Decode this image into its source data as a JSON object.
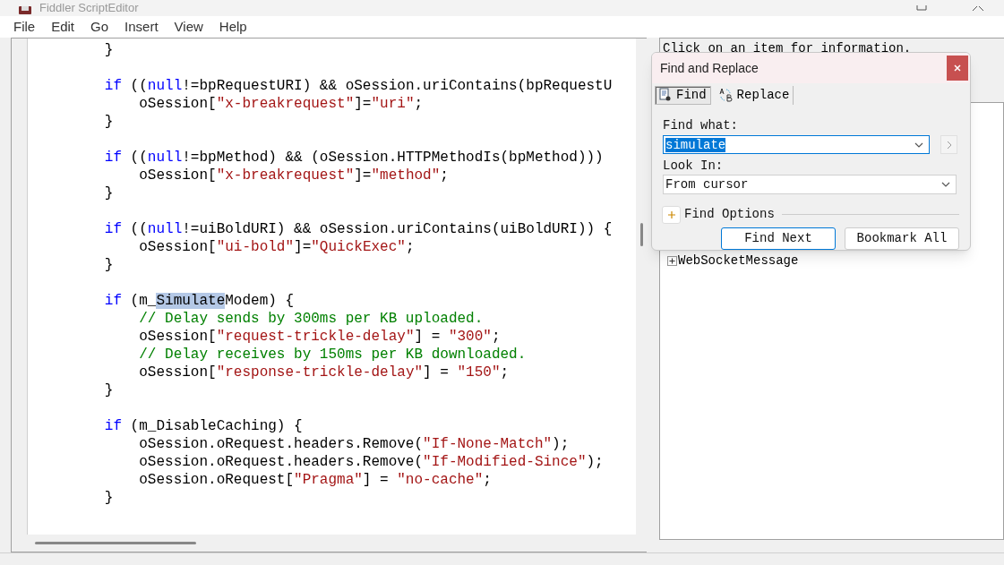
{
  "window": {
    "title": "Fiddler ScriptEditor"
  },
  "menu": [
    "File",
    "Edit",
    "Go",
    "Insert",
    "View",
    "Help"
  ],
  "editor": {
    "lines": [
      {
        "kind": "code",
        "segments": [
          {
            "kind": "plain",
            "text": "        }"
          }
        ]
      },
      {
        "kind": "blank"
      },
      {
        "kind": "code",
        "segments": [
          {
            "kind": "keyword",
            "text": "        if"
          },
          {
            "kind": "plain",
            "text": " (("
          },
          {
            "kind": "keyword",
            "text": "null"
          },
          {
            "kind": "plain",
            "text": "!=bpRequestURI) && oSession.uriContains(bpRequestU"
          }
        ]
      },
      {
        "kind": "code",
        "segments": [
          {
            "kind": "plain",
            "text": "            oSession["
          },
          {
            "kind": "string",
            "text": "\"x-breakrequest\""
          },
          {
            "kind": "plain",
            "text": "]="
          },
          {
            "kind": "string",
            "text": "\"uri\""
          },
          {
            "kind": "plain",
            "text": ";"
          }
        ]
      },
      {
        "kind": "code",
        "segments": [
          {
            "kind": "plain",
            "text": "        }"
          }
        ]
      },
      {
        "kind": "blank"
      },
      {
        "kind": "code",
        "segments": [
          {
            "kind": "keyword",
            "text": "        if"
          },
          {
            "kind": "plain",
            "text": " (("
          },
          {
            "kind": "keyword",
            "text": "null"
          },
          {
            "kind": "plain",
            "text": "!=bpMethod) && (oSession.HTTPMethodIs(bpMethod)))"
          }
        ]
      },
      {
        "kind": "code",
        "segments": [
          {
            "kind": "plain",
            "text": "            oSession["
          },
          {
            "kind": "string",
            "text": "\"x-breakrequest\""
          },
          {
            "kind": "plain",
            "text": "]="
          },
          {
            "kind": "string",
            "text": "\"method\""
          },
          {
            "kind": "plain",
            "text": ";"
          }
        ]
      },
      {
        "kind": "code",
        "segments": [
          {
            "kind": "plain",
            "text": "        }"
          }
        ]
      },
      {
        "kind": "blank"
      },
      {
        "kind": "code",
        "segments": [
          {
            "kind": "keyword",
            "text": "        if"
          },
          {
            "kind": "plain",
            "text": " (("
          },
          {
            "kind": "keyword",
            "text": "null"
          },
          {
            "kind": "plain",
            "text": "!=uiBoldURI) && oSession.uriContains(uiBoldURI)) {"
          }
        ]
      },
      {
        "kind": "code",
        "segments": [
          {
            "kind": "plain",
            "text": "            oSession["
          },
          {
            "kind": "string",
            "text": "\"ui-bold\""
          },
          {
            "kind": "plain",
            "text": "]="
          },
          {
            "kind": "string",
            "text": "\"QuickExec\""
          },
          {
            "kind": "plain",
            "text": ";"
          }
        ]
      },
      {
        "kind": "code",
        "segments": [
          {
            "kind": "plain",
            "text": "        }"
          }
        ]
      },
      {
        "kind": "blank"
      },
      {
        "kind": "code",
        "segments": [
          {
            "kind": "keyword",
            "text": "        if"
          },
          {
            "kind": "plain",
            "text": " (m_"
          },
          {
            "kind": "match",
            "text": "Simulate"
          },
          {
            "kind": "plain",
            "text": "Modem) {"
          }
        ]
      },
      {
        "kind": "code",
        "segments": [
          {
            "kind": "comment",
            "text": "            // Delay sends by 300ms per KB uploaded."
          }
        ]
      },
      {
        "kind": "code",
        "segments": [
          {
            "kind": "plain",
            "text": "            oSession["
          },
          {
            "kind": "string",
            "text": "\"request-trickle-delay\""
          },
          {
            "kind": "plain",
            "text": "] = "
          },
          {
            "kind": "string",
            "text": "\"300\""
          },
          {
            "kind": "plain",
            "text": ";"
          }
        ]
      },
      {
        "kind": "code",
        "segments": [
          {
            "kind": "comment",
            "text": "            // Delay receives by 150ms per KB downloaded."
          }
        ]
      },
      {
        "kind": "code",
        "segments": [
          {
            "kind": "plain",
            "text": "            oSession["
          },
          {
            "kind": "string",
            "text": "\"response-trickle-delay\""
          },
          {
            "kind": "plain",
            "text": "] = "
          },
          {
            "kind": "string",
            "text": "\"150\""
          },
          {
            "kind": "plain",
            "text": ";"
          }
        ]
      },
      {
        "kind": "code",
        "segments": [
          {
            "kind": "plain",
            "text": "        }"
          }
        ]
      },
      {
        "kind": "blank"
      },
      {
        "kind": "code",
        "segments": [
          {
            "kind": "keyword",
            "text": "        if"
          },
          {
            "kind": "plain",
            "text": " (m_DisableCaching) {"
          }
        ]
      },
      {
        "kind": "code",
        "segments": [
          {
            "kind": "plain",
            "text": "            oSession.oRequest.headers.Remove("
          },
          {
            "kind": "string",
            "text": "\"If-None-Match\""
          },
          {
            "kind": "plain",
            "text": ");"
          }
        ]
      },
      {
        "kind": "code",
        "segments": [
          {
            "kind": "plain",
            "text": "            oSession.oRequest.headers.Remove("
          },
          {
            "kind": "string",
            "text": "\"If-Modified-Since\""
          },
          {
            "kind": "plain",
            "text": ");"
          }
        ]
      },
      {
        "kind": "code",
        "segments": [
          {
            "kind": "plain",
            "text": "            oSession.oRequest["
          },
          {
            "kind": "string",
            "text": "\"Pragma\""
          },
          {
            "kind": "plain",
            "text": "] = "
          },
          {
            "kind": "string",
            "text": "\"no-cache\""
          },
          {
            "kind": "plain",
            "text": ";"
          }
        ]
      },
      {
        "kind": "code",
        "segments": [
          {
            "kind": "plain",
            "text": "        }"
          }
        ]
      }
    ]
  },
  "info_panel": {
    "text": "Click on an item for information."
  },
  "tree": {
    "items": [
      {
        "label": "WebSocketMessage",
        "expanded": false
      }
    ]
  },
  "dialog": {
    "title": "Find and Replace",
    "tabs": [
      {
        "label": "Find",
        "selected": true
      },
      {
        "label": "Replace",
        "selected": false
      }
    ],
    "find_what": {
      "label": "Find what:",
      "value": "simulate"
    },
    "look_in": {
      "label": "Look In:",
      "value": "From cursor"
    },
    "find_options": {
      "label": "Find Options",
      "expanded": false
    },
    "buttons": [
      {
        "label": "Find Next",
        "default": true
      },
      {
        "label": "Bookmark All",
        "default": false
      }
    ]
  }
}
